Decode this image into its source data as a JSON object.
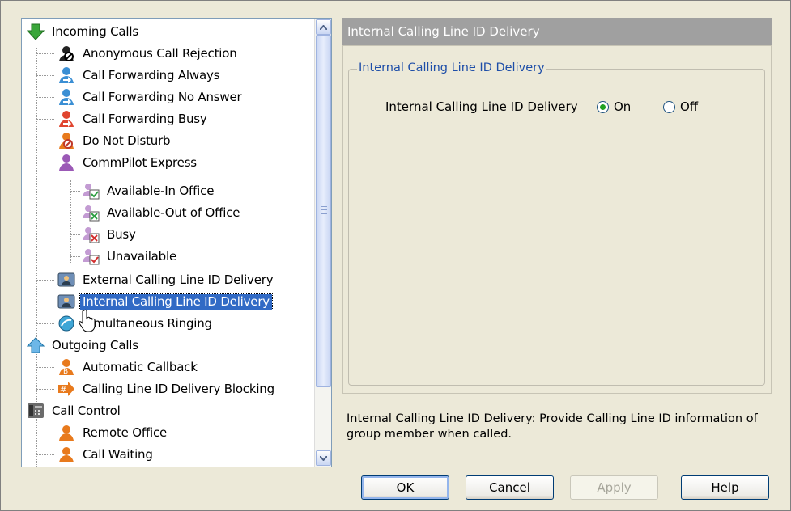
{
  "tree": {
    "nodes": [
      {
        "label": "Incoming Calls",
        "icon": "incoming-calls-icon"
      },
      {
        "label": "Anonymous Call Rejection",
        "icon": "anonymous-rejection-icon"
      },
      {
        "label": "Call Forwarding Always",
        "icon": "forwarding-always-icon"
      },
      {
        "label": "Call Forwarding No Answer",
        "icon": "forwarding-no-answer-icon"
      },
      {
        "label": "Call Forwarding Busy",
        "icon": "forwarding-busy-icon"
      },
      {
        "label": "Do Not Disturb",
        "icon": "do-not-disturb-icon"
      },
      {
        "label": "CommPilot Express",
        "icon": "commpilot-icon"
      },
      {
        "label": "Available-In Office",
        "icon": "available-in-office-icon"
      },
      {
        "label": "Available-Out of Office",
        "icon": "available-out-office-icon"
      },
      {
        "label": "Busy",
        "icon": "busy-icon"
      },
      {
        "label": "Unavailable",
        "icon": "unavailable-icon"
      },
      {
        "label": "External Calling Line ID Delivery",
        "icon": "external-clid-icon"
      },
      {
        "label": "Internal Calling Line ID Delivery",
        "icon": "internal-clid-icon"
      },
      {
        "label": "Simultaneous Ringing",
        "icon": "simultaneous-ringing-icon"
      },
      {
        "label": "Outgoing Calls",
        "icon": "outgoing-calls-icon"
      },
      {
        "label": "Automatic Callback",
        "icon": "automatic-callback-icon"
      },
      {
        "label": "Calling Line ID Delivery Blocking",
        "icon": "clid-blocking-icon"
      },
      {
        "label": "Call Control",
        "icon": "call-control-icon"
      },
      {
        "label": "Remote Office",
        "icon": "remote-office-icon"
      },
      {
        "label": "Call Waiting",
        "icon": "call-waiting-icon"
      }
    ],
    "selected": "Internal Calling Line ID Delivery"
  },
  "header": {
    "title": "Internal Calling Line ID Delivery"
  },
  "group": {
    "title": "Internal Calling Line ID Delivery",
    "setting_label": "Internal Calling Line ID Delivery",
    "option_on": "On",
    "option_off": "Off",
    "selected": "On"
  },
  "description": "Internal Calling Line ID Delivery: Provide Calling Line ID information of group member when called.",
  "buttons": {
    "ok": "OK",
    "cancel": "Cancel",
    "apply": "Apply",
    "help": "Help"
  },
  "colors": {
    "selection": "#316ac5",
    "header_bg": "#a0a0a0",
    "group_title": "#1e4ea8"
  }
}
